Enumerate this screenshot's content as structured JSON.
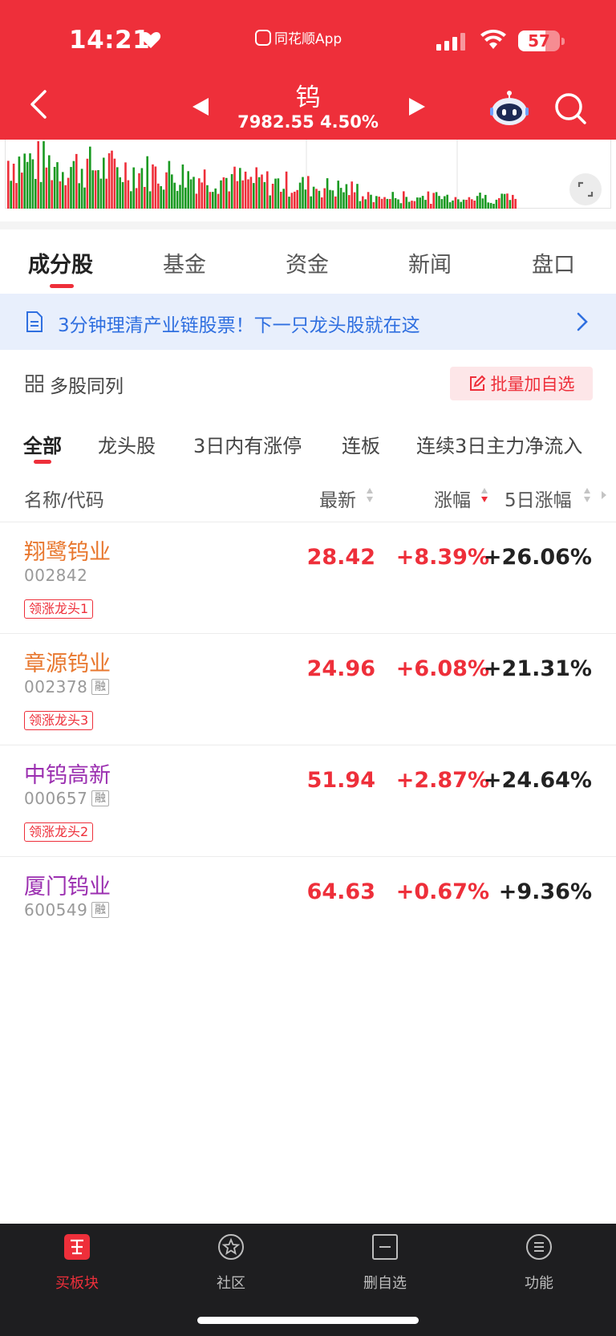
{
  "status_bar": {
    "time": "14:21",
    "app_name": "同花顺App",
    "battery": "57"
  },
  "header": {
    "title": "钨",
    "price": "7982.55",
    "change_pct": "4.50%"
  },
  "tabs": [
    {
      "label": "成分股",
      "active": true
    },
    {
      "label": "基金",
      "active": false
    },
    {
      "label": "资金",
      "active": false
    },
    {
      "label": "新闻",
      "active": false
    },
    {
      "label": "盘口",
      "active": false
    }
  ],
  "banner": {
    "text": "3分钟理清产业链股票！下一只龙头股就在这"
  },
  "toolbar": {
    "multi_label": "多股同列",
    "batch_label": "批量加自选"
  },
  "filters": [
    {
      "label": "全部",
      "active": true
    },
    {
      "label": "龙头股",
      "active": false
    },
    {
      "label": "3日内有涨停",
      "active": false
    },
    {
      "label": "连板",
      "active": false
    },
    {
      "label": "连续3日主力净流入",
      "active": false
    }
  ],
  "table": {
    "headers": {
      "name": "名称/代码",
      "latest": "最新",
      "change": "涨幅",
      "change5": "5日涨幅"
    },
    "rows": [
      {
        "name": "翔鹭钨业",
        "code": "002842",
        "margin": "",
        "tag": "领涨龙头1",
        "latest": "28.42",
        "change": "+8.39%",
        "change5": "+26.06%",
        "name_color": "#e8772e"
      },
      {
        "name": "章源钨业",
        "code": "002378",
        "margin": "融",
        "tag": "领涨龙头3",
        "latest": "24.96",
        "change": "+6.08%",
        "change5": "+21.31%",
        "name_color": "#e8772e"
      },
      {
        "name": "中钨高新",
        "code": "000657",
        "margin": "融",
        "tag": "领涨龙头2",
        "latest": "51.94",
        "change": "+2.87%",
        "change5": "+24.64%",
        "name_color": "#9b2fb0"
      },
      {
        "name": "厦门钨业",
        "code": "600549",
        "margin": "融",
        "tag": "",
        "latest": "64.63",
        "change": "+0.67%",
        "change5": "+9.36%",
        "name_color": "#9b2fb0"
      }
    ]
  },
  "bottom_nav": [
    {
      "label": "买板块",
      "icon": "buy-sector-icon"
    },
    {
      "label": "社区",
      "icon": "community-icon"
    },
    {
      "label": "删自选",
      "icon": "remove-watchlist-icon"
    },
    {
      "label": "功能",
      "icon": "menu-icon"
    }
  ],
  "colors": {
    "brand_red": "#ee2f3a",
    "up": "#ee2f3a",
    "down": "#1a9a22",
    "banner_blue": "#2f6fe0"
  }
}
